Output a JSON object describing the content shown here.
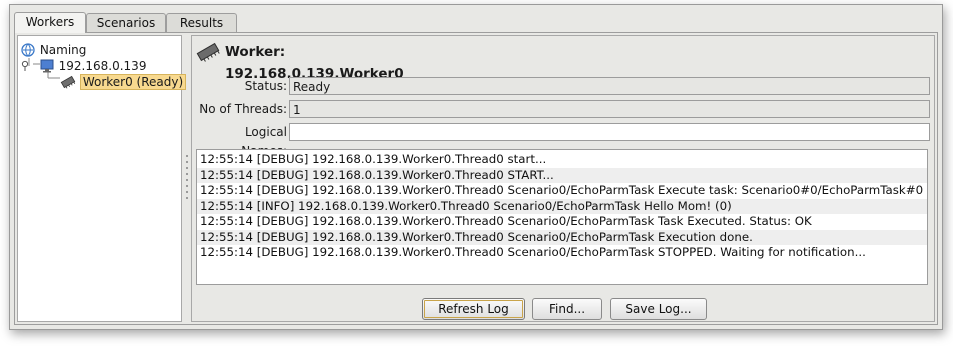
{
  "tabs": [
    "Workers",
    "Scenarios",
    "Results"
  ],
  "tree": {
    "root": {
      "label": "Naming",
      "icon": "naming-globe-icon"
    },
    "host": {
      "label": "192.168.0.139",
      "icon": "computer-monitor-icon"
    },
    "worker": {
      "label": "Worker0 (Ready)",
      "icon": "worker-chip-icon",
      "selected": true
    }
  },
  "worker": {
    "title": "Worker: 192.168.0.139.Worker0",
    "status_label": "Status:",
    "status_value": "Ready",
    "threads_label": "No of Threads:",
    "threads_value": "1",
    "logical_names_label": "Logical Names:",
    "logical_names_value": ""
  },
  "log": [
    "12:55:14 [DEBUG] 192.168.0.139.Worker0.Thread0  start...",
    "12:55:14 [DEBUG] 192.168.0.139.Worker0.Thread0  START...",
    "12:55:14 [DEBUG] 192.168.0.139.Worker0.Thread0 Scenario0/EchoParmTask Execute task: Scenario0#0/EchoParmTask#0",
    "12:55:14 [INFO] 192.168.0.139.Worker0.Thread0 Scenario0/EchoParmTask Hello Mom! (0)",
    "12:55:14 [DEBUG] 192.168.0.139.Worker0.Thread0 Scenario0/EchoParmTask Task Executed. Status: OK",
    "12:55:14 [DEBUG] 192.168.0.139.Worker0.Thread0 Scenario0/EchoParmTask Execution done.",
    "12:55:14 [DEBUG] 192.168.0.139.Worker0.Thread0 Scenario0/EchoParmTask STOPPED. Waiting for notification..."
  ],
  "buttons": {
    "refresh": "Refresh Log",
    "find": "Find...",
    "save": "Save Log..."
  },
  "colors": {
    "selection": "#f8d98f",
    "window_bg": "#e8e8e5"
  }
}
